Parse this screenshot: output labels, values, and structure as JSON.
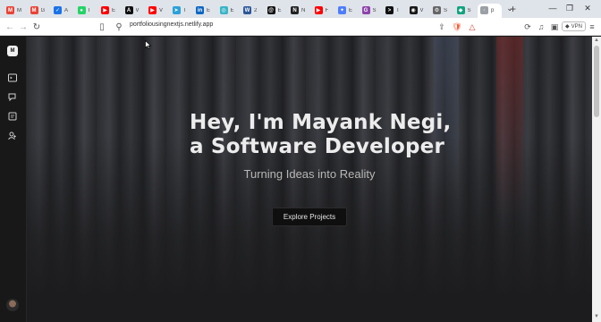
{
  "browser": {
    "tabs": [
      {
        "title": "M",
        "icon": "gmail-icon",
        "color": "#ea4335",
        "glyph": "M"
      },
      {
        "title": "G",
        "icon": "gmail-icon",
        "color": "#ea4335",
        "glyph": "M"
      },
      {
        "title": "A",
        "icon": "google-tasks-icon",
        "color": "#1a73e8",
        "glyph": "✓"
      },
      {
        "title": "I",
        "icon": "whatsapp-icon",
        "color": "#25d366",
        "glyph": "●"
      },
      {
        "title": "E",
        "icon": "youtube-icon",
        "color": "#ff0000",
        "glyph": "▶"
      },
      {
        "title": "V",
        "icon": "app-icon",
        "color": "#111111",
        "glyph": "A"
      },
      {
        "title": "V",
        "icon": "youtube-icon",
        "color": "#ff0000",
        "glyph": "▶"
      },
      {
        "title": "T",
        "icon": "telegram-icon",
        "color": "#2aa1da",
        "glyph": "➤"
      },
      {
        "title": "E",
        "icon": "linkedin-icon",
        "color": "#0a66c2",
        "glyph": "in"
      },
      {
        "title": "E",
        "icon": "globe-icon",
        "color": "#37b5c6",
        "glyph": "◎"
      },
      {
        "title": "2",
        "icon": "word-icon",
        "color": "#2b579a",
        "glyph": "W"
      },
      {
        "title": "E",
        "icon": "threads-icon",
        "color": "#111111",
        "glyph": "@"
      },
      {
        "title": "N",
        "icon": "notion-icon",
        "color": "#222222",
        "glyph": "N"
      },
      {
        "title": "F",
        "icon": "youtube-icon",
        "color": "#ff0000",
        "glyph": "▶"
      },
      {
        "title": "E",
        "icon": "gemini-icon",
        "color": "#4d7cfe",
        "glyph": "✦"
      },
      {
        "title": "S",
        "icon": "app-icon",
        "color": "#8e44ad",
        "glyph": "G"
      },
      {
        "title": "T",
        "icon": "terminal-icon",
        "color": "#111111",
        "glyph": ">"
      },
      {
        "title": "V",
        "icon": "github-icon",
        "color": "#181717",
        "glyph": "◉"
      },
      {
        "title": "S",
        "icon": "settings-icon",
        "color": "#666666",
        "glyph": "⚙"
      },
      {
        "title": "S",
        "icon": "chatgpt-icon",
        "color": "#10a37f",
        "glyph": "◆"
      },
      {
        "title": "p",
        "icon": "page-icon",
        "color": "#9aa0a6",
        "glyph": "·",
        "active": true
      }
    ],
    "address": "portfoliousingnextjs.netlify.app",
    "vpn_label": "VPN"
  },
  "hero": {
    "line1": "Hey, I'm Mayank Negi,",
    "line2": "a  Software Developer",
    "tagline": "Turning Ideas into Reality",
    "cta_label": "Explore Projects"
  },
  "sidebar": {
    "logo_text": "M"
  }
}
